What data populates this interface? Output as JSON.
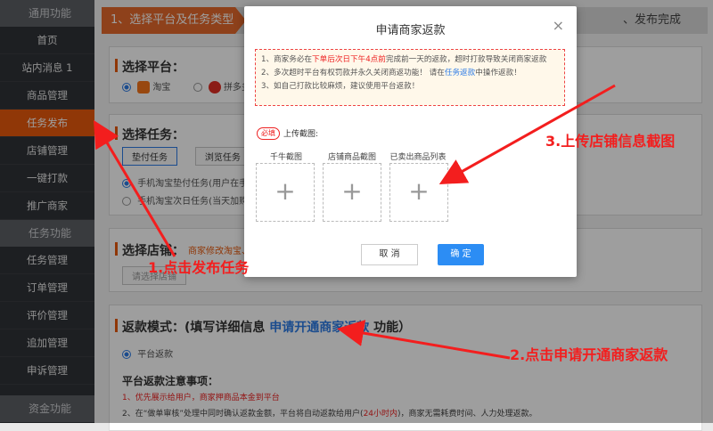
{
  "sidebar": {
    "group1": "通用功能",
    "items1": [
      {
        "label": "首页"
      },
      {
        "label": "站内消息 1"
      },
      {
        "label": "商品管理"
      },
      {
        "label": "任务发布"
      },
      {
        "label": "店铺管理"
      },
      {
        "label": "一键打款"
      },
      {
        "label": "推广商家"
      }
    ],
    "group2": "任务功能",
    "items2": [
      {
        "label": "任务管理"
      },
      {
        "label": "订单管理"
      },
      {
        "label": "评价管理"
      },
      {
        "label": "追加管理"
      },
      {
        "label": "申诉管理"
      }
    ],
    "group3": "资金功能"
  },
  "steps": {
    "step1": "1、选择平台及任务类型",
    "step_last": "、发布完成"
  },
  "platform": {
    "title": "选择平台：",
    "opt1": "淘宝",
    "opt2": "拼多多"
  },
  "task": {
    "title": "选择任务：",
    "btn1": "垫付任务",
    "btn2": "浏览任务",
    "line1": "手机淘宝垫付任务(用户在手",
    "line2": "手机淘宝次日任务(当天加购物"
  },
  "shop": {
    "title": "选择店铺：",
    "hint": "商家修改淘宝、",
    "select": "请选择店铺"
  },
  "refund": {
    "title_a": "返款模式：(填写详细信息",
    "title_link": "申请开通商家返款",
    "title_b": "功能）",
    "option": "平台返款",
    "notes_title": "平台返款注意事项：",
    "note1": "1、优先展示给用户，商家押商品本金到平台",
    "note2_a": "2、在“做单审核”处理中同时确认返款金额，平台将自动返款给用户(",
    "note2_red": "24小时内",
    "note2_b": ")，商家无需耗费时间、人力处理返款。"
  },
  "modal": {
    "title": "申请商家返款",
    "close": "×",
    "notice": {
      "l1_a": "1、商家务必在",
      "l1_red": "下单后次日下午4点前",
      "l1_b": "完成前一天的返款，超时打款导致关闭商家返款",
      "l2_a": "2、多次超时平台有权罚款并永久关闭商返功能！ 请在",
      "l2_link": "任务返款",
      "l2_b": "中操作返款！",
      "l3": "3、如自己打款比较麻烦，建议使用平台返款！"
    },
    "required_tag": "必填",
    "upload_title": "上传截图:",
    "uploads": [
      {
        "label": "千牛截图",
        "icon": "+"
      },
      {
        "label": "店铺商品截图",
        "icon": "+"
      },
      {
        "label": "已卖出商品列表",
        "icon": "+"
      }
    ],
    "cancel": "取 消",
    "ok": "确 定"
  },
  "annotations": {
    "a1": "1.点击发布任务",
    "a2": "2.点击申请开通商家返款",
    "a3": "3.上传店铺信息截图"
  },
  "colors": {
    "accent": "#e8590c",
    "annotation": "#f31e1e",
    "primary": "#2c8df4"
  }
}
